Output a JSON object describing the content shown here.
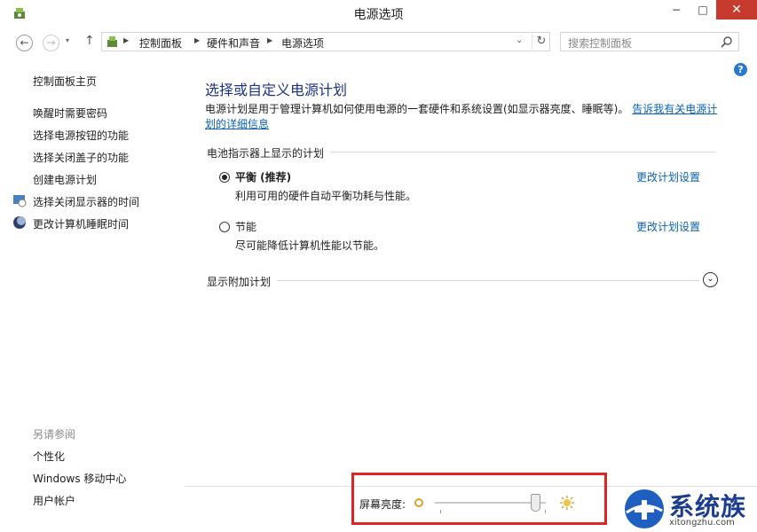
{
  "window": {
    "title": "电源选项",
    "minimize": "−",
    "maximize": "□",
    "close": "✕"
  },
  "nav": {
    "back": "←",
    "forward": "→",
    "recent": "▾",
    "up": "↑",
    "breadcrumbs": [
      "控制面板",
      "硬件和声音",
      "电源选项"
    ],
    "separator": "▶",
    "dropdown": "⌄",
    "refresh": "↻",
    "search_placeholder": "搜索控制面板"
  },
  "help": "?",
  "sidebar": {
    "home": "控制面板主页",
    "links": [
      "唤醒时需要密码",
      "选择电源按钮的功能",
      "选择关闭盖子的功能",
      "创建电源计划",
      "选择关闭显示器的时间",
      "更改计算机睡眠时间"
    ],
    "see_also_title": "另请参阅",
    "see_also": [
      "个性化",
      "Windows 移动中心",
      "用户帐户"
    ]
  },
  "main": {
    "title": "选择或自定义电源计划",
    "description": "电源计划是用于管理计算机如何使用电源的一套硬件和系统设置(如显示器亮度、睡眠等)。",
    "description_link": "告诉我有关电源计划的详细信息",
    "group_title": "电池指示器上显示的计划",
    "plans": [
      {
        "name": "平衡 (推荐)",
        "desc": "利用可用的硬件自动平衡功耗与性能。",
        "selected": true,
        "link": "更改计划设置"
      },
      {
        "name": "节能",
        "desc": "尽可能降低计算机性能以节能。",
        "selected": false,
        "link": "更改计划设置"
      }
    ],
    "more_plans": "显示附加计划",
    "expand": "⌄"
  },
  "brightness": {
    "label": "屏幕亮度:",
    "level_percent": 95
  },
  "watermark": {
    "text": "系统族",
    "url": "xitongzhu.com"
  },
  "colors": {
    "accent": "#2b78d0",
    "close": "#c73b2f",
    "highlight_box": "#e02424",
    "link": "#0b61b5",
    "title": "#1e3287"
  }
}
